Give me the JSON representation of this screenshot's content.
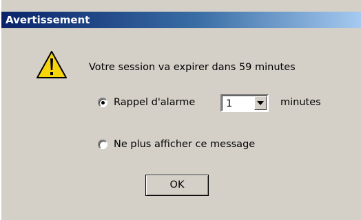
{
  "dialog": {
    "title": "Avertissement",
    "icon": "warning-icon",
    "message": "Votre session va expirer dans 59 minutes",
    "options": {
      "reminder_label": "Rappel d'alarme",
      "reminder_selected": true,
      "reminder_value": "1",
      "reminder_unit": "minutes",
      "dont_show_label": "Ne plus afficher ce message",
      "dont_show_selected": false
    },
    "ok_label": "OK"
  },
  "colors": {
    "titlebar_start": "#0a246a",
    "titlebar_end": "#a6caf0",
    "dialog_background": "#d4d0c8",
    "warning_yellow": "#f7d50b"
  }
}
